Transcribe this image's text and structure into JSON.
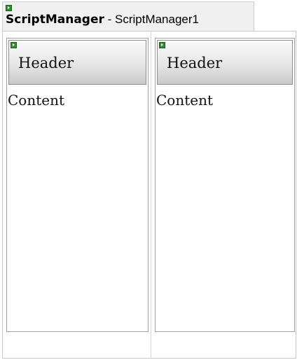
{
  "script_manager": {
    "type_name": "ScriptManager",
    "separator": " - ",
    "instance_id": "ScriptManager1",
    "tag_icon": "smart-tag-glyph"
  },
  "panels": [
    {
      "header": "Header",
      "content": "Content",
      "tag_icon": "smart-tag-glyph"
    },
    {
      "header": "Header",
      "content": "Content",
      "tag_icon": "smart-tag-glyph"
    }
  ],
  "colors": {
    "smart_tag": "#2f8f2f",
    "panel_border": "#a0a0a0",
    "header_gradient_top": "#fafafa",
    "header_gradient_bottom": "#c9c9c9"
  }
}
